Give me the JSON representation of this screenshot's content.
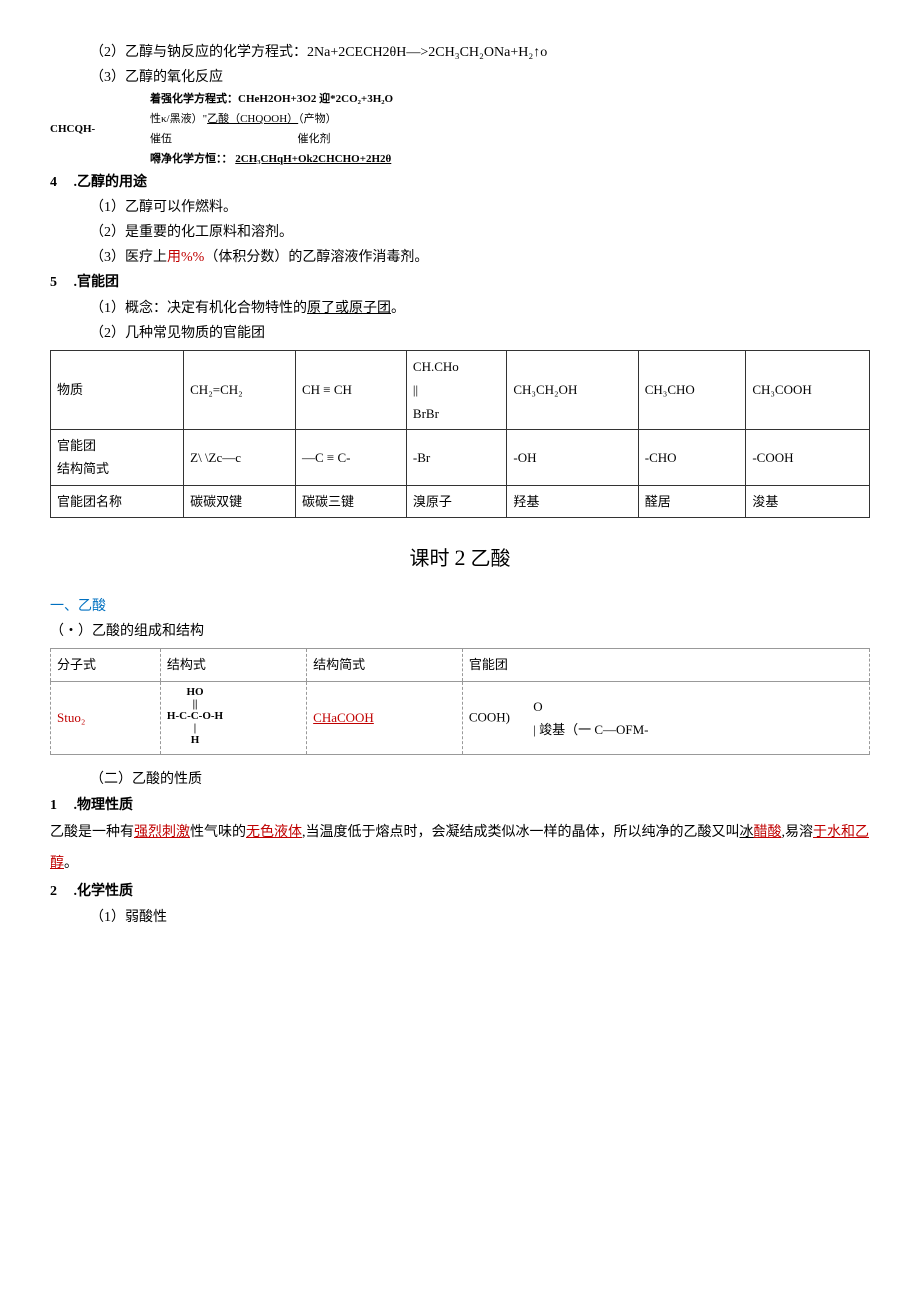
{
  "item2": {
    "label": "（2）乙醇与钠反应的化学方程式：",
    "eq": "2Na+2CECH2θH—>2CH₃CH₂ONa+H₂↑o"
  },
  "item3": {
    "label": "（3）乙醇的氧化反应"
  },
  "oxid": {
    "left_label": "CHCQH-",
    "line1": "着强化学方程式：CHeH2OH+3O2 迎*2CO₂+3H₂O",
    "line2a": "性κ/黑液）\"",
    "line2b": "乙酸（CHQOOH）",
    "line2c": "（产物）",
    "line3a": "催伍",
    "line3b": "催化剂",
    "line4a": "嘚净化学方恒：：",
    "line4b": "2CH₃CHqH+Ok2CHCHO+2H2θ"
  },
  "sec4": {
    "num": "4",
    "title": ".乙醇的用途",
    "p1": "（1）乙醇可以作燃料。",
    "p2": "（2）是重要的化工原料和溶剂。",
    "p3a": "（3）医疗上",
    "p3b": "用%%",
    "p3c": "（体积分数）的乙醇溶液作消毒剂。"
  },
  "sec5": {
    "num": "5",
    "title": ".官能团",
    "p1a": "（1）概念：决定有机化合物特性的",
    "p1b": "原了或原子团",
    "p1c": "。",
    "p2": "（2）几种常见物质的官能团"
  },
  "table1": {
    "r1": [
      "物质",
      "CH₂=CH₂",
      "CH ≡ CH",
      "CH.CHo\n||\nBrBr",
      "CH₃CH₂OH",
      "CH₃CHO",
      "CH₃COOH"
    ],
    "r2": [
      "官能团\n结构简式",
      "Z\\    \\Zc—c",
      "—C ≡ C-",
      "-Br",
      "-OH",
      "-CHO",
      "-COOH"
    ],
    "r3": [
      "官能团名称",
      "碳碳双键",
      "碳碳三键",
      "溴原子",
      "羟基",
      "醛居",
      "浚基"
    ]
  },
  "title2a": "课时 ",
  "title2b": "2",
  "title2c": " 乙酸",
  "secA": {
    "h": "一、乙酸",
    "sub1": "（・）乙酸的组成和结构"
  },
  "table2": {
    "h": [
      "分子式",
      "结构式",
      "结构简式",
      "官能团"
    ],
    "r": {
      "c1": "Stuo₂",
      "c2_l1": "HO",
      "c2_l2": "||",
      "c2_l3": "H-C-C-O-H",
      "c2_l4": "|",
      "c2_l5": "H",
      "c3": "CHaCOOH",
      "c4a": "COOH)",
      "c4b": "O\n| 竣基（一 C—OFM-"
    }
  },
  "secB": {
    "h": "（二）乙酸的性质"
  },
  "sec1b": {
    "num": "1",
    "title": ".物理性质",
    "p_a": "乙酸是一种有",
    "p_b": "强烈刺激",
    "p_c": "性气味的",
    "p_d": "无色液体",
    "p_e": ",当温度低于熔点时，会凝结成类似冰一样的晶体，所以纯净的乙酸又叫",
    "p_f": "冰",
    "p_g": "醋酸",
    "p_h": ",易溶",
    "p_i": "于水和乙醇",
    "p_j": "。"
  },
  "sec2b": {
    "num": "2",
    "title": ".化学性质",
    "p1": "（1）弱酸性"
  }
}
